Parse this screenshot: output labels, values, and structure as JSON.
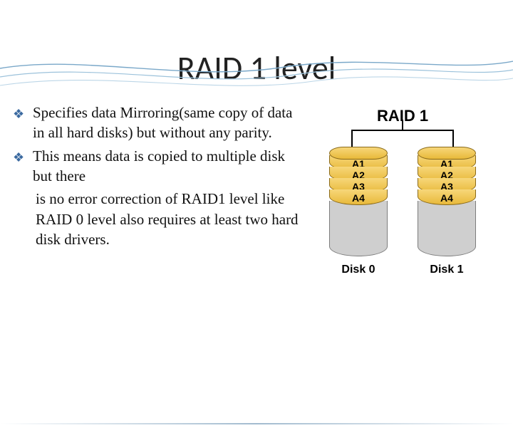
{
  "title": "RAID 1 level",
  "bullets": [
    "Specifies data Mirroring(same copy of data in all hard disks) but without any parity.",
    "This means data is copied to multiple disk  but there"
  ],
  "continuation": " is no error correction of RAID1 level like RAID 0 level also requires at least two hard disk drivers.",
  "diagram": {
    "heading": "RAID 1",
    "disks": [
      {
        "label": "Disk 0",
        "blocks": [
          "A1",
          "A2",
          "A3",
          "A4"
        ]
      },
      {
        "label": "Disk 1",
        "blocks": [
          "A1",
          "A2",
          "A3",
          "A4"
        ]
      }
    ]
  }
}
